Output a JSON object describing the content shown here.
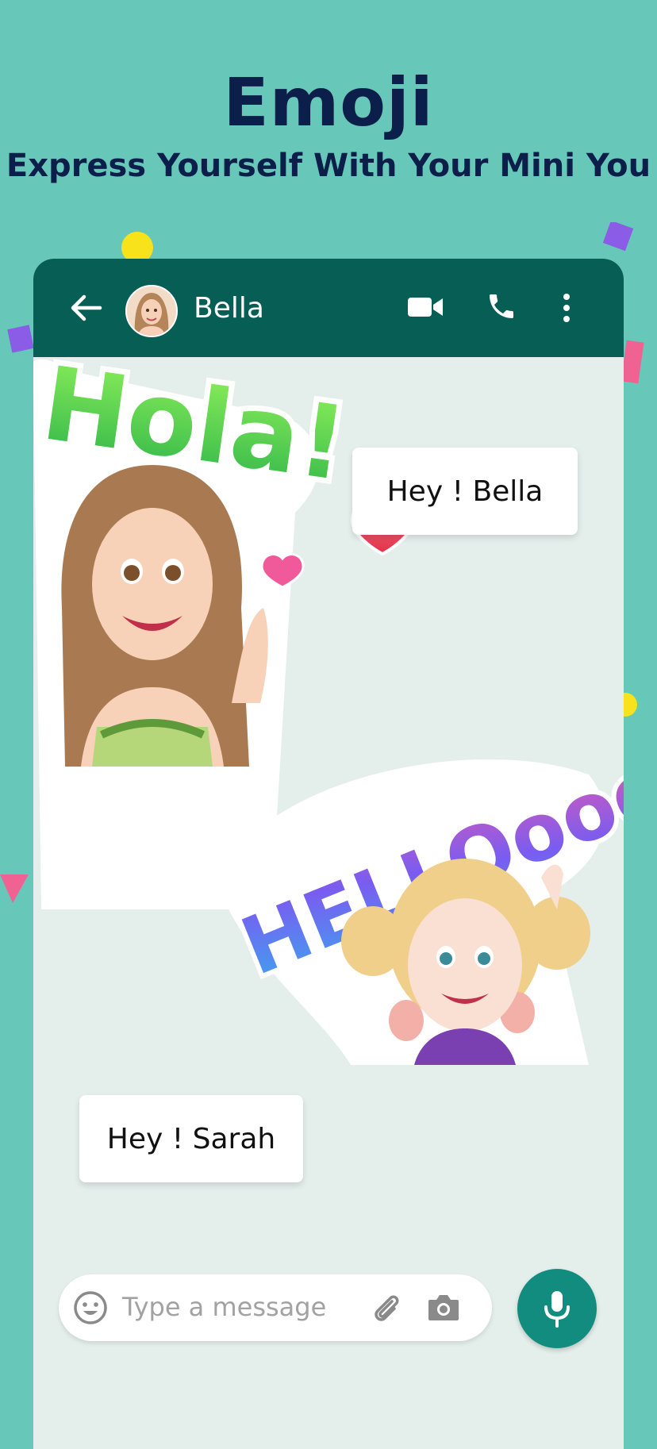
{
  "hero": {
    "title": "Emoji",
    "subtitle": "Express Yourself With Your Mini You"
  },
  "chat_header": {
    "contact_name": "Bella",
    "icons": [
      "back-arrow-icon",
      "video-call-icon",
      "phone-icon",
      "more-vert-icon"
    ]
  },
  "messages": [
    {
      "side": "right",
      "text": "Hey ! Bella"
    },
    {
      "side": "left",
      "text": "Hey ! Sarah"
    }
  ],
  "stickers": [
    {
      "text": "Hola!"
    },
    {
      "text": "HELLOooo"
    }
  ],
  "composer": {
    "placeholder": "Type a message",
    "icons": [
      "emoji-icon",
      "attach-icon",
      "camera-icon",
      "mic-icon"
    ]
  },
  "colors": {
    "background": "#67c8b9",
    "app_bar": "#075e55",
    "chat_bg": "#e4eeeb",
    "mic_button": "#128c7e",
    "title_text": "#0c1f4a"
  }
}
